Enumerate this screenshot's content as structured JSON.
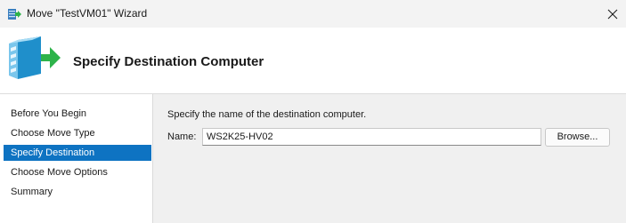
{
  "window": {
    "title": "Move \"TestVM01\" Wizard"
  },
  "header": {
    "title": "Specify Destination Computer"
  },
  "sidebar": {
    "items": [
      {
        "label": "Before You Begin"
      },
      {
        "label": "Choose Move Type"
      },
      {
        "label": "Specify Destination"
      },
      {
        "label": "Choose Move Options"
      },
      {
        "label": "Summary"
      }
    ],
    "active_index": 2
  },
  "main": {
    "instruction": "Specify the name of the destination computer.",
    "name_label": "Name:",
    "name_value": "WS2K25-HV02",
    "browse_label": "Browse..."
  },
  "colors": {
    "accent": "#0e73c2",
    "arrow_green": "#2db34a",
    "server_blue": "#2aa3dc"
  }
}
